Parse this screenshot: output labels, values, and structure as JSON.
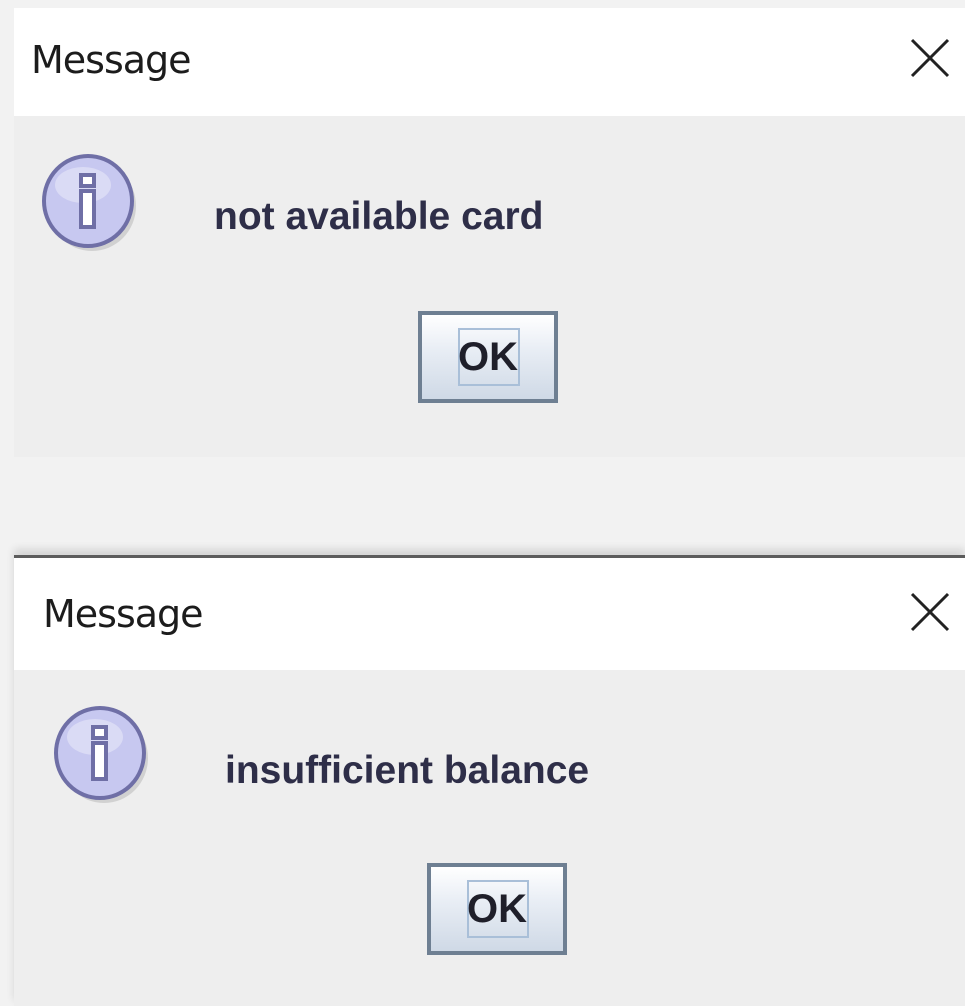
{
  "dialogs": [
    {
      "title": "Message",
      "message": "not available card",
      "ok_label": "OK"
    },
    {
      "title": "Message",
      "message": "insufficient balance",
      "ok_label": "OK"
    }
  ],
  "icons": {
    "info": "info-icon",
    "close": "close-icon"
  },
  "colors": {
    "icon_fill": "#c7c8f0",
    "icon_stroke": "#6f6fa6",
    "button_border": "#6e7f92",
    "message_text": "#2e2e48"
  }
}
